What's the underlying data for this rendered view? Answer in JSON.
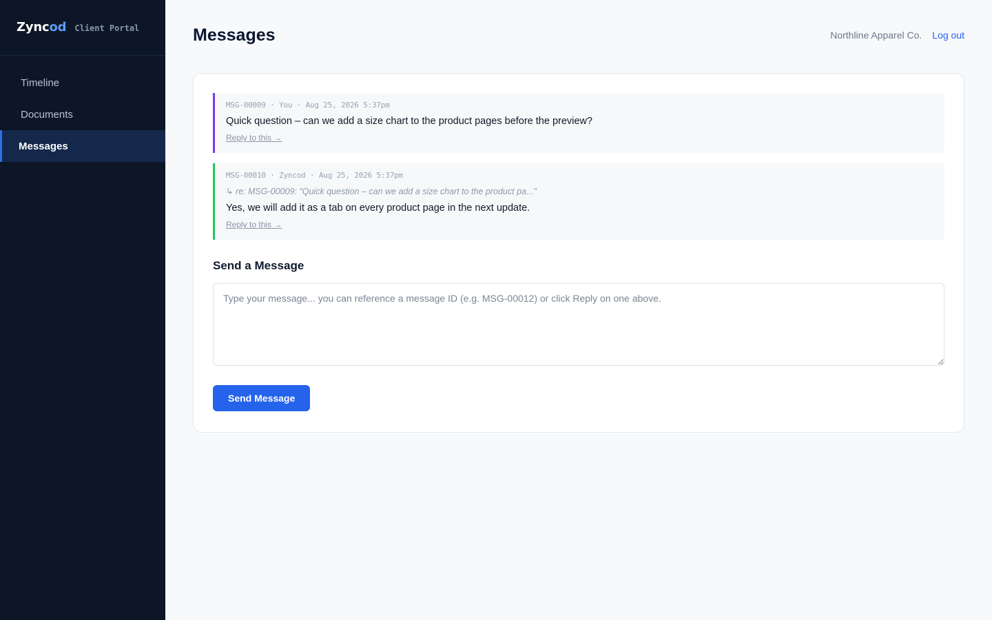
{
  "brand": {
    "name_main": "Zync",
    "name_accent": "od",
    "subtitle": "Client Portal"
  },
  "nav": {
    "items": [
      {
        "label": "Timeline",
        "active": false
      },
      {
        "label": "Documents",
        "active": false
      },
      {
        "label": "Messages",
        "active": true
      }
    ]
  },
  "header": {
    "title": "Messages",
    "company": "Northline Apparel Co.",
    "logout_label": "Log out"
  },
  "messages": [
    {
      "id": "MSG-00009",
      "meta": "MSG-00009 · You · Aug 25, 2026 5:37pm",
      "quote": "",
      "body": "Quick question – can we add a size chart to the product pages before the preview?",
      "reply_label": "Reply to this →"
    },
    {
      "id": "MSG-00010",
      "meta": "MSG-00010 · Zyncod · Aug 25, 2026 5:37pm",
      "quote": "↳ re: MSG-00009: \"Quick question – can we add a size chart to the product pa...\"",
      "body": "Yes, we will add it as a tab on every product page in the next update.",
      "reply_label": "Reply to this →"
    }
  ],
  "compose": {
    "title": "Send a Message",
    "placeholder": "Type your message... you can reference a message ID (e.g. MSG-00012) or click Reply on one above.",
    "value": "",
    "send_label": "Send Message"
  },
  "colors": {
    "sidebar_bg": "#0c1627",
    "accent": "#2563eb",
    "client_message_border": "#7c3aed",
    "staff_message_border": "#22c55e"
  }
}
